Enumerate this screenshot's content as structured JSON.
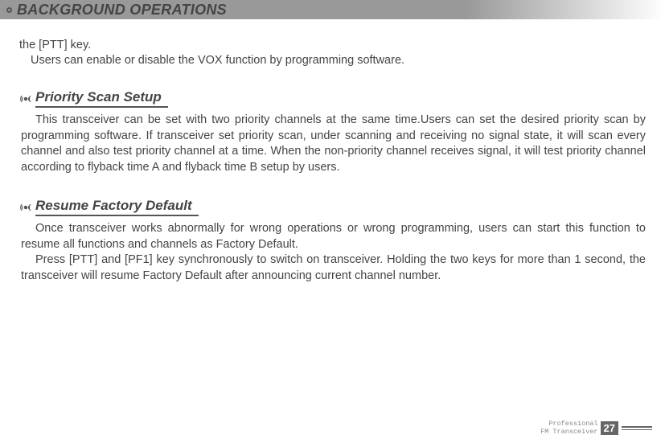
{
  "header": {
    "title": "BACKGROUND OPERATIONS"
  },
  "intro": {
    "line1": "the [PTT] key.",
    "line2": "Users can enable or disable the VOX function by programming software."
  },
  "sections": {
    "priority_scan": {
      "title": "Priority Scan Setup",
      "body": "This transceiver can be set with two priority channels at the same time.Users can set the desired priority scan by programming software. If transceiver set priority scan, under scanning and receiving no signal state, it will scan every channel and also test priority channel at a time. When the non-priority channel receives signal, it will test priority channel according to flyback time A and flyback time B setup by users."
    },
    "factory_default": {
      "title": "Resume Factory Default",
      "para1": "Once transceiver works abnormally for wrong operations or wrong programming, users can start this function to resume all functions and channels as Factory Default.",
      "para2": "Press [PTT] and [PF1] key synchronously to switch on transceiver. Holding the two keys for more than 1 second, the transceiver will resume Factory Default after announcing current channel number."
    }
  },
  "footer": {
    "text1": "Professional",
    "text2": "FM Transceiver",
    "page": "27"
  }
}
